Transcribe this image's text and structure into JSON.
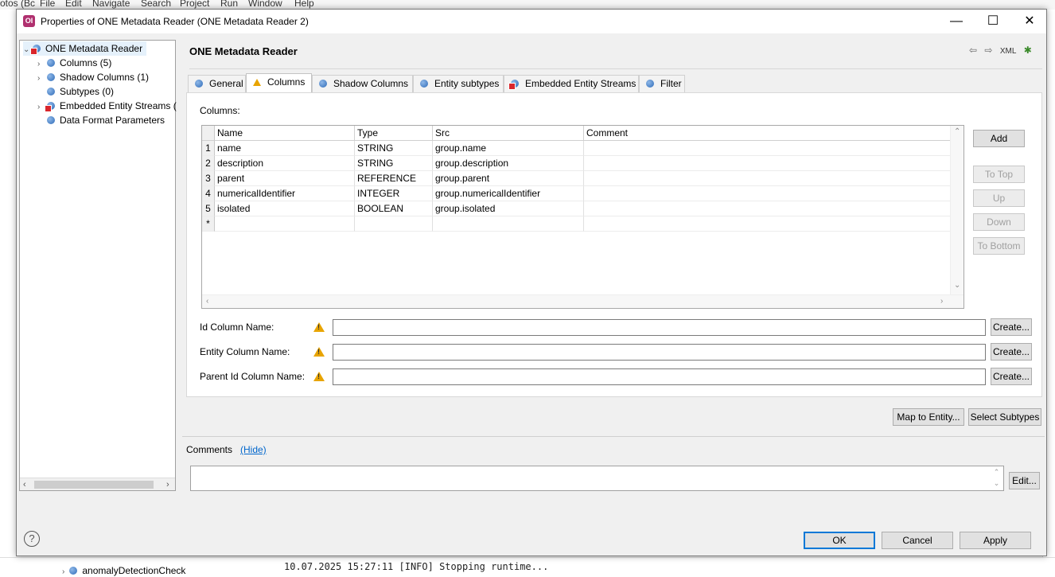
{
  "background": {
    "menubar_items": [
      "otos (Bc",
      "File",
      "Edit",
      "Navigate",
      "Search",
      "Project",
      "Run",
      "Window",
      "Help"
    ],
    "tree_fragment": "anomalyDetectionCheck",
    "log_fragment": "10.07.2025 15:27:11 [INFO]     Stopping runtime..."
  },
  "dialog": {
    "title": "Properties of ONE Metadata Reader (ONE Metadata Reader 2)",
    "app_icon_text": "OI",
    "window_controls": {
      "minimize": "—",
      "maximize": "☐",
      "close": "✕"
    }
  },
  "tree": {
    "items": [
      {
        "label": "ONE Metadata Reader",
        "expanded": true,
        "level": 0,
        "error": true,
        "selected": true
      },
      {
        "label": "Columns (5)",
        "expandable": true,
        "level": 1
      },
      {
        "label": "Shadow Columns (1)",
        "expandable": true,
        "level": 1
      },
      {
        "label": "Subtypes (0)",
        "expandable": false,
        "level": 1
      },
      {
        "label": "Embedded Entity Streams (",
        "expandable": true,
        "level": 1,
        "error": true
      },
      {
        "label": "Data Format Parameters",
        "expandable": false,
        "level": 1
      }
    ]
  },
  "editor": {
    "title": "ONE Metadata Reader",
    "tools": {
      "back": "⇦",
      "forward": "⇨",
      "xml": "XML",
      "bug": "✱"
    }
  },
  "tabs": [
    {
      "label": "General",
      "icon": "node-icon",
      "active": false
    },
    {
      "label": "Columns",
      "icon": "warning-icon",
      "active": true
    },
    {
      "label": "Shadow Columns",
      "icon": "node-icon",
      "active": false
    },
    {
      "label": "Entity subtypes",
      "icon": "node-icon",
      "active": false
    },
    {
      "label": "Embedded Entity Streams",
      "icon": "error-node-icon",
      "active": false
    },
    {
      "label": "Filter",
      "icon": "node-icon",
      "active": false
    }
  ],
  "columns_panel": {
    "label": "Columns:",
    "headers": [
      "Name",
      "Type",
      "Src",
      "Comment"
    ],
    "rows": [
      {
        "num": "1",
        "name": "name",
        "type": "STRING",
        "src": "group.name",
        "comment": ""
      },
      {
        "num": "2",
        "name": "description",
        "type": "STRING",
        "src": "group.description",
        "comment": ""
      },
      {
        "num": "3",
        "name": "parent",
        "type": "REFERENCE",
        "src": "group.parent",
        "comment": ""
      },
      {
        "num": "4",
        "name": "numericalIdentifier",
        "type": "INTEGER",
        "src": "group.numericalIdentifier",
        "comment": ""
      },
      {
        "num": "5",
        "name": "isolated",
        "type": "BOOLEAN",
        "src": "group.isolated",
        "comment": ""
      }
    ],
    "new_row_marker": "*",
    "buttons": {
      "add": "Add",
      "to_top": "To Top",
      "up": "Up",
      "down": "Down",
      "to_bottom": "To Bottom"
    }
  },
  "fields": [
    {
      "label": "Id Column Name:",
      "value": "",
      "button": "Create..."
    },
    {
      "label": "Entity Column Name:",
      "value": "",
      "button": "Create..."
    },
    {
      "label": "Parent Id Column Name:",
      "value": "",
      "button": "Create..."
    }
  ],
  "actions": {
    "map_to_entity": "Map to Entity...",
    "select_subtypes": "Select Subtypes"
  },
  "comments": {
    "label": "Comments",
    "hide_link": "(Hide)",
    "value": "",
    "edit_button": "Edit..."
  },
  "footer": {
    "help": "?",
    "ok": "OK",
    "cancel": "Cancel",
    "apply": "Apply"
  }
}
